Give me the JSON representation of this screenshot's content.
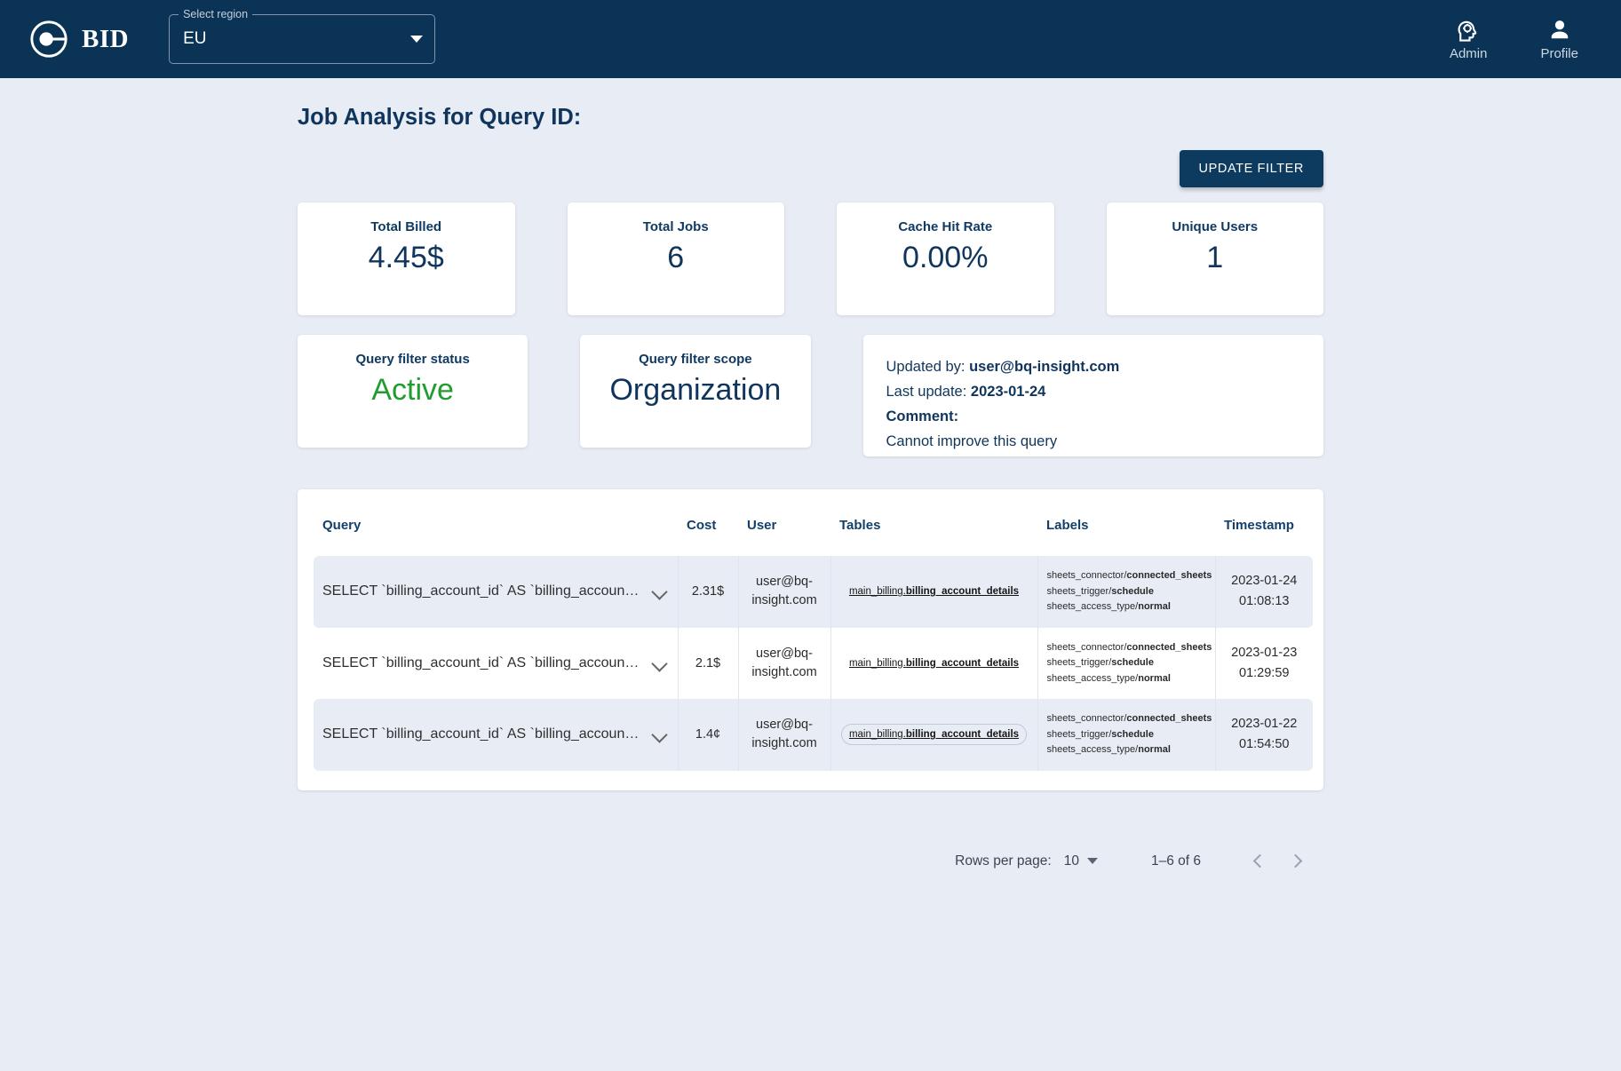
{
  "appbar": {
    "brand_name": "BID",
    "region_select": {
      "label": "Select region",
      "value": "EU"
    },
    "admin_label": "Admin",
    "profile_label": "Profile"
  },
  "page": {
    "title": "Job Analysis for Query ID:",
    "update_filter_label": "UPDATE FILTER"
  },
  "stats": [
    {
      "label": "Total Billed",
      "value": "4.45$"
    },
    {
      "label": "Total Jobs",
      "value": "6"
    },
    {
      "label": "Cache Hit Rate",
      "value": "0.00%"
    },
    {
      "label": "Unique Users",
      "value": "1"
    }
  ],
  "filter_cards": {
    "status": {
      "label": "Query filter status",
      "value": "Active"
    },
    "scope": {
      "label": "Query filter scope",
      "value": "Organization"
    }
  },
  "meta": {
    "updated_by_label": "Updated by: ",
    "updated_by_value": "user@bq-insight.com",
    "last_update_label": "Last update: ",
    "last_update_value": "2023-01-24",
    "comment_label": "Comment:",
    "comment_value": "Cannot improve this query"
  },
  "table": {
    "headers": {
      "query": "Query",
      "cost": "Cost",
      "user": "User",
      "tables": "Tables",
      "labels": "Labels",
      "timestamp": "Timestamp"
    },
    "rows": [
      {
        "query": "SELECT `billing_account_id` AS `billing_account…",
        "cost": "2.31$",
        "user": "user@bq-insight.com",
        "table_prefix": "main_billing.",
        "table_name": "billing_account_details",
        "labels": [
          {
            "key": "sheets_connector/",
            "value": "connected_sheets"
          },
          {
            "key": "sheets_trigger/",
            "value": "schedule"
          },
          {
            "key": "sheets_access_type/",
            "value": "normal"
          }
        ],
        "date": "2023-01-24",
        "time": "01:08:13"
      },
      {
        "query": "SELECT `billing_account_id` AS `billing_account…",
        "cost": "2.1$",
        "user": "user@bq-insight.com",
        "table_prefix": "main_billing.",
        "table_name": "billing_account_details",
        "labels": [
          {
            "key": "sheets_connector/",
            "value": "connected_sheets"
          },
          {
            "key": "sheets_trigger/",
            "value": "schedule"
          },
          {
            "key": "sheets_access_type/",
            "value": "normal"
          }
        ],
        "date": "2023-01-23",
        "time": "01:29:59"
      },
      {
        "query": "SELECT `billing_account_id` AS `billing_account…",
        "cost": "1.4¢",
        "user": "user@bq-insight.com",
        "table_prefix": "main_billing.",
        "table_name": "billing_account_details",
        "labels": [
          {
            "key": "sheets_connector/",
            "value": "connected_sheets"
          },
          {
            "key": "sheets_trigger/",
            "value": "schedule"
          },
          {
            "key": "sheets_access_type/",
            "value": "normal"
          }
        ],
        "date": "2023-01-22",
        "time": "01:54:50"
      }
    ]
  },
  "pagination": {
    "rows_per_page_label": "Rows per page:",
    "rows_per_page_value": "10",
    "range_label": "1–6 of 6"
  },
  "colors": {
    "appbar_bg": "#0a3355",
    "page_bg": "#e8ecf4",
    "accent_navy": "#10355c",
    "status_green": "#1f9d2f",
    "row_shaded": "#e8edf5"
  }
}
